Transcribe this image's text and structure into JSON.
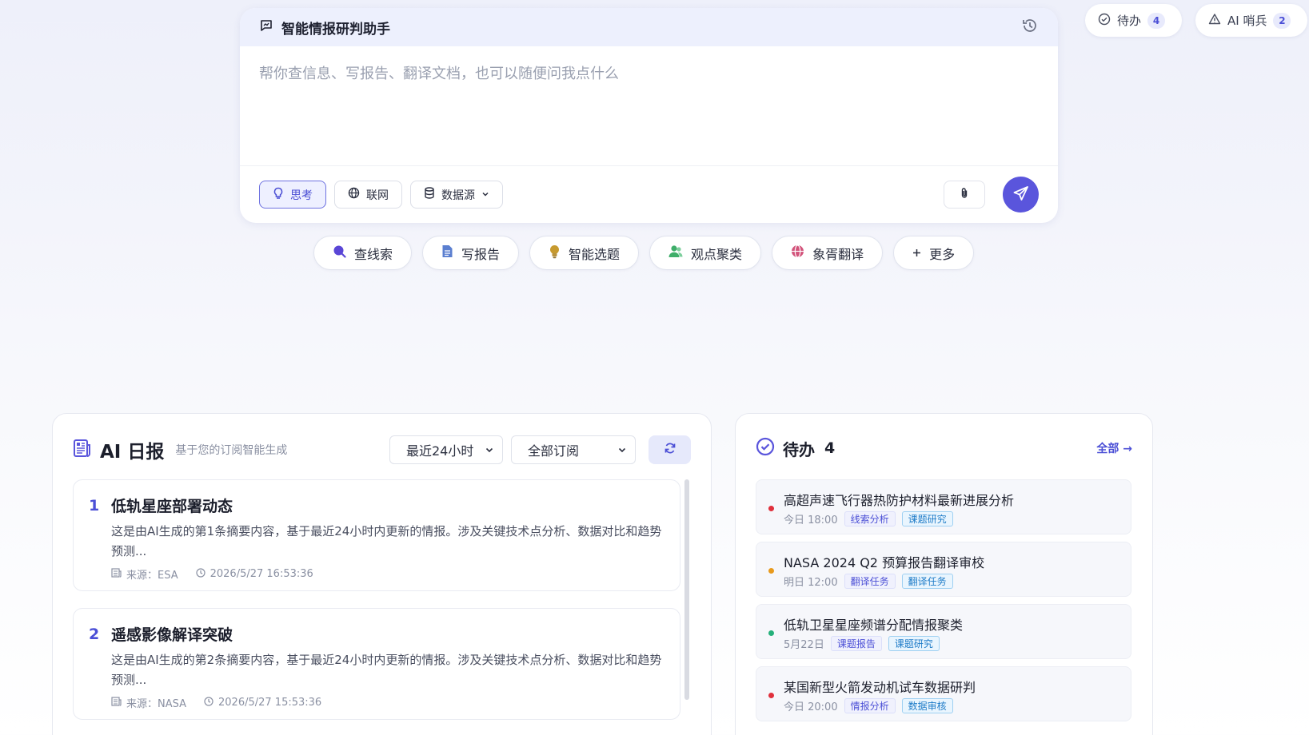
{
  "top_pills": {
    "todo": {
      "label": "待办",
      "count": "4"
    },
    "sentinel": {
      "label": "AI 哨兵",
      "count": "2"
    }
  },
  "assistant": {
    "title": "智能情报研判助手",
    "placeholder": "帮你查信息、写报告、翻译文档，也可以随便问我点什么",
    "tools": {
      "think": "思考",
      "web": "联网",
      "datasource": "数据源"
    }
  },
  "quick_actions": [
    {
      "label": "查线索",
      "icon": "search-icon",
      "color": "#5a46d6"
    },
    {
      "label": "写报告",
      "icon": "document-icon",
      "color": "#5b7fd0"
    },
    {
      "label": "智能选题",
      "icon": "lightbulb-icon",
      "color": "#c79a2f"
    },
    {
      "label": "观点聚类",
      "icon": "people-icon",
      "color": "#3fae6a"
    },
    {
      "label": "象胥翻译",
      "icon": "globe-icon",
      "color": "#d2527a"
    },
    {
      "label": "更多",
      "icon": "plus-icon",
      "color": "#2a2e3e"
    }
  ],
  "daily": {
    "title": "AI 日报",
    "subtitle": "基于您的订阅智能生成",
    "time_filter": "最近24小时",
    "subscription_filter": "全部订阅",
    "items": [
      {
        "num": "1",
        "title": "低轨星座部署动态",
        "body": "这是由AI生成的第1条摘要内容，基于最近24小时内更新的情报。涉及关键技术点分析、数据对比和趋势预测...",
        "source": "来源：ESA",
        "time": "2026/5/27 16:53:36"
      },
      {
        "num": "2",
        "title": "遥感影像解译突破",
        "body": "这是由AI生成的第2条摘要内容，基于最近24小时内更新的情报。涉及关键技术点分析、数据对比和趋势预测...",
        "source": "来源：NASA",
        "time": "2026/5/27 15:53:36"
      }
    ]
  },
  "todo": {
    "title": "待办",
    "count": "4",
    "all_link": "全部 →",
    "items": [
      {
        "title": "高超声速飞行器热防护材料最新进展分析",
        "time": "今日 18:00",
        "tag1": "线索分析",
        "tag2": "课题研究",
        "dot": "#e0303c"
      },
      {
        "title": "NASA 2024 Q2 预算报告翻译审校",
        "time": "明日 12:00",
        "tag1": "翻译任务",
        "tag2": "翻译任务",
        "dot": "#e89a1c"
      },
      {
        "title": "低轨卫星星座频谱分配情报聚类",
        "time": "5月22日",
        "tag1": "课题报告",
        "tag2": "课题研究",
        "dot": "#25b07a"
      },
      {
        "title": "某国新型火箭发动机试车数据研判",
        "time": "今日 20:00",
        "tag1": "情报分析",
        "tag2": "数据审核",
        "dot": "#e0303c"
      }
    ]
  },
  "colors": {
    "accent": "#5a55dc",
    "accent_text": "#4b4fd6"
  }
}
